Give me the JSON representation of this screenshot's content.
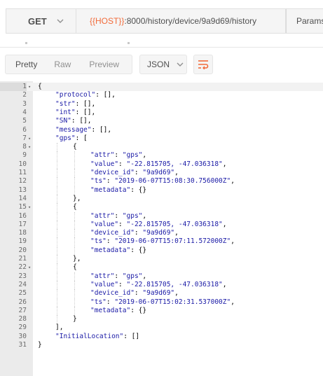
{
  "request": {
    "method": "GET",
    "url_variable": "{{HOST}}",
    "url_rest": ":8000/history/device/9a9d69/history",
    "params_label": "Params"
  },
  "response_toolbar": {
    "views": [
      "Pretty",
      "Raw",
      "Preview"
    ],
    "active_view": "Pretty",
    "format": "JSON"
  },
  "editor": {
    "lines": [
      {
        "n": "1",
        "fold": "▾",
        "indent": 0,
        "tokens": [
          [
            "p",
            "{"
          ]
        ]
      },
      {
        "n": "2",
        "fold": "",
        "indent": 1,
        "tokens": [
          [
            "s",
            "\"protocol\""
          ],
          [
            "p",
            ": [],"
          ]
        ]
      },
      {
        "n": "3",
        "fold": "",
        "indent": 1,
        "tokens": [
          [
            "s",
            "\"str\""
          ],
          [
            "p",
            ": [],"
          ]
        ]
      },
      {
        "n": "4",
        "fold": "",
        "indent": 1,
        "tokens": [
          [
            "s",
            "\"int\""
          ],
          [
            "p",
            ": [],"
          ]
        ]
      },
      {
        "n": "5",
        "fold": "",
        "indent": 1,
        "tokens": [
          [
            "s",
            "\"SN\""
          ],
          [
            "p",
            ": [],"
          ]
        ]
      },
      {
        "n": "6",
        "fold": "",
        "indent": 1,
        "tokens": [
          [
            "s",
            "\"message\""
          ],
          [
            "p",
            ": [],"
          ]
        ]
      },
      {
        "n": "7",
        "fold": "▾",
        "indent": 1,
        "tokens": [
          [
            "s",
            "\"gps\""
          ],
          [
            "p",
            ": ["
          ]
        ]
      },
      {
        "n": "8",
        "fold": "▾",
        "indent": 2,
        "tokens": [
          [
            "p",
            "{"
          ]
        ]
      },
      {
        "n": "9",
        "fold": "",
        "indent": 3,
        "tokens": [
          [
            "s",
            "\"attr\""
          ],
          [
            "p",
            ": "
          ],
          [
            "s",
            "\"gps\""
          ],
          [
            "p",
            ","
          ]
        ]
      },
      {
        "n": "10",
        "fold": "",
        "indent": 3,
        "tokens": [
          [
            "s",
            "\"value\""
          ],
          [
            "p",
            ": "
          ],
          [
            "s",
            "\"-22.815705, -47.036318\""
          ],
          [
            "p",
            ","
          ]
        ]
      },
      {
        "n": "11",
        "fold": "",
        "indent": 3,
        "tokens": [
          [
            "s",
            "\"device_id\""
          ],
          [
            "p",
            ": "
          ],
          [
            "s",
            "\"9a9d69\""
          ],
          [
            "p",
            ","
          ]
        ]
      },
      {
        "n": "12",
        "fold": "",
        "indent": 3,
        "tokens": [
          [
            "s",
            "\"ts\""
          ],
          [
            "p",
            ": "
          ],
          [
            "s",
            "\"2019-06-07T15:08:30.756000Z\""
          ],
          [
            "p",
            ","
          ]
        ]
      },
      {
        "n": "13",
        "fold": "",
        "indent": 3,
        "tokens": [
          [
            "s",
            "\"metadata\""
          ],
          [
            "p",
            ": {}"
          ]
        ]
      },
      {
        "n": "14",
        "fold": "",
        "indent": 2,
        "tokens": [
          [
            "p",
            "},"
          ]
        ]
      },
      {
        "n": "15",
        "fold": "▾",
        "indent": 2,
        "tokens": [
          [
            "p",
            "{"
          ]
        ]
      },
      {
        "n": "16",
        "fold": "",
        "indent": 3,
        "tokens": [
          [
            "s",
            "\"attr\""
          ],
          [
            "p",
            ": "
          ],
          [
            "s",
            "\"gps\""
          ],
          [
            "p",
            ","
          ]
        ]
      },
      {
        "n": "17",
        "fold": "",
        "indent": 3,
        "tokens": [
          [
            "s",
            "\"value\""
          ],
          [
            "p",
            ": "
          ],
          [
            "s",
            "\"-22.815705, -47.036318\""
          ],
          [
            "p",
            ","
          ]
        ]
      },
      {
        "n": "18",
        "fold": "",
        "indent": 3,
        "tokens": [
          [
            "s",
            "\"device_id\""
          ],
          [
            "p",
            ": "
          ],
          [
            "s",
            "\"9a9d69\""
          ],
          [
            "p",
            ","
          ]
        ]
      },
      {
        "n": "19",
        "fold": "",
        "indent": 3,
        "tokens": [
          [
            "s",
            "\"ts\""
          ],
          [
            "p",
            ": "
          ],
          [
            "s",
            "\"2019-06-07T15:07:11.572000Z\""
          ],
          [
            "p",
            ","
          ]
        ]
      },
      {
        "n": "20",
        "fold": "",
        "indent": 3,
        "tokens": [
          [
            "s",
            "\"metadata\""
          ],
          [
            "p",
            ": {}"
          ]
        ]
      },
      {
        "n": "21",
        "fold": "",
        "indent": 2,
        "tokens": [
          [
            "p",
            "},"
          ]
        ]
      },
      {
        "n": "22",
        "fold": "▾",
        "indent": 2,
        "tokens": [
          [
            "p",
            "{"
          ]
        ]
      },
      {
        "n": "23",
        "fold": "",
        "indent": 3,
        "tokens": [
          [
            "s",
            "\"attr\""
          ],
          [
            "p",
            ": "
          ],
          [
            "s",
            "\"gps\""
          ],
          [
            "p",
            ","
          ]
        ]
      },
      {
        "n": "24",
        "fold": "",
        "indent": 3,
        "tokens": [
          [
            "s",
            "\"value\""
          ],
          [
            "p",
            ": "
          ],
          [
            "s",
            "\"-22.815705, -47.036318\""
          ],
          [
            "p",
            ","
          ]
        ]
      },
      {
        "n": "25",
        "fold": "",
        "indent": 3,
        "tokens": [
          [
            "s",
            "\"device_id\""
          ],
          [
            "p",
            ": "
          ],
          [
            "s",
            "\"9a9d69\""
          ],
          [
            "p",
            ","
          ]
        ]
      },
      {
        "n": "26",
        "fold": "",
        "indent": 3,
        "tokens": [
          [
            "s",
            "\"ts\""
          ],
          [
            "p",
            ": "
          ],
          [
            "s",
            "\"2019-06-07T15:02:31.537000Z\""
          ],
          [
            "p",
            ","
          ]
        ]
      },
      {
        "n": "27",
        "fold": "",
        "indent": 3,
        "tokens": [
          [
            "s",
            "\"metadata\""
          ],
          [
            "p",
            ": {}"
          ]
        ]
      },
      {
        "n": "28",
        "fold": "",
        "indent": 2,
        "tokens": [
          [
            "p",
            "}"
          ]
        ]
      },
      {
        "n": "29",
        "fold": "",
        "indent": 1,
        "tokens": [
          [
            "p",
            "],"
          ]
        ]
      },
      {
        "n": "30",
        "fold": "",
        "indent": 1,
        "tokens": [
          [
            "s",
            "\"InitialLocation\""
          ],
          [
            "p",
            ": []"
          ]
        ]
      },
      {
        "n": "31",
        "fold": "",
        "indent": 0,
        "tokens": [
          [
            "p",
            "}"
          ]
        ]
      }
    ]
  },
  "colors": {
    "accent": "#f26b3a",
    "string": "#1a1aa6",
    "gutter": "#ebebeb"
  },
  "icons": {
    "method_dropdown": "chevron-down-icon",
    "format_dropdown": "chevron-down-icon",
    "wrap_button": "wrap-lines-icon"
  }
}
